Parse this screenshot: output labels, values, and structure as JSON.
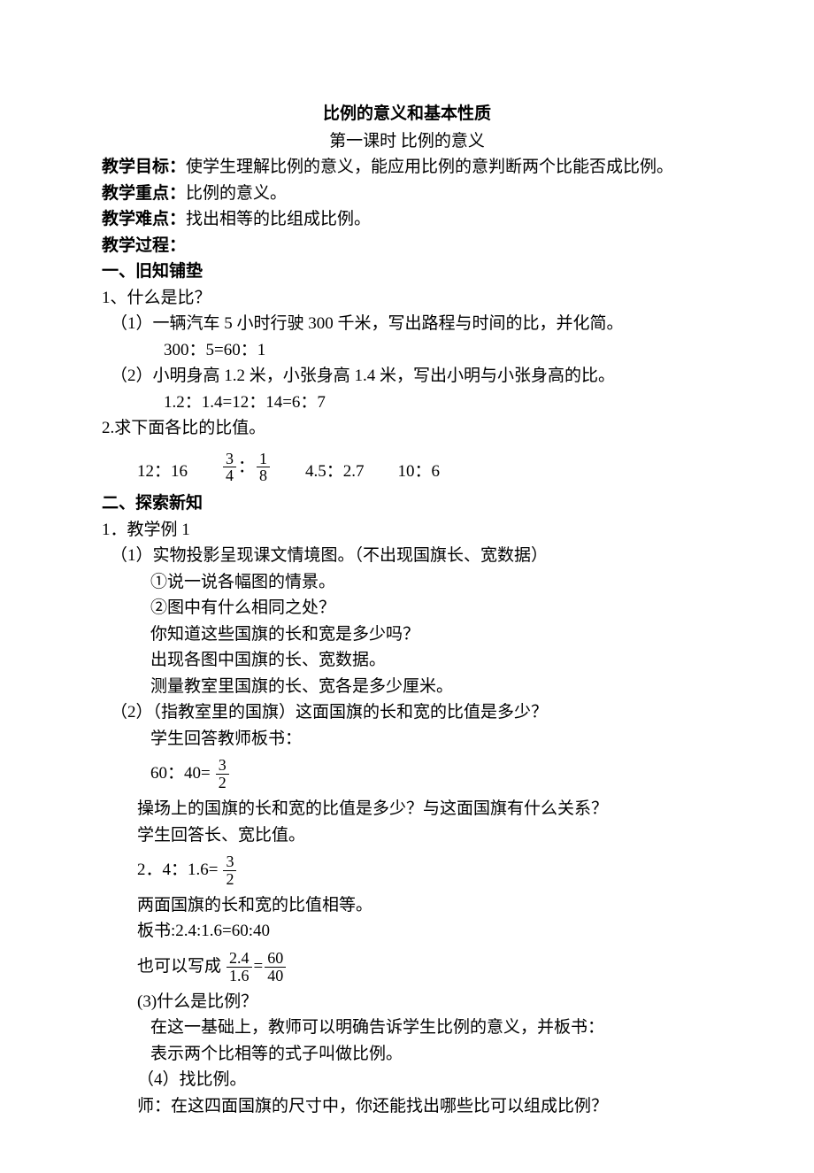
{
  "title": "比例的意义和基本性质",
  "subtitle": "第一课时 比例的意义",
  "goal_label": "教学目标：",
  "goal_text": "使学生理解比例的意义，能应用比例的意判断两个比能否成比例。",
  "focus_label": "教学重点：",
  "focus_text": "比例的意义。",
  "diff_label": "教学难点：",
  "diff_text": "找出相等的比组成比例。",
  "proc_label": "教学过程：",
  "s1_h": "一、旧知铺垫",
  "s1_q1": "1、什么是比？",
  "s1_q1a": "（1）一辆汽车 5 小时行驶 300 千米，写出路程与时间的比，并化简。",
  "s1_q1a_eq": "300：5=60：1",
  "s1_q1b": "（2）小明身高 1.2 米，小张身高 1.4 米，写出小明与小张身高的比。",
  "s1_q1b_eq": "1.2：1.4=12：14=6：7",
  "s1_q2": "2.求下面各比的比值。",
  "ratios": {
    "r1": "12：16",
    "r2a": {
      "num": "3",
      "den": "4"
    },
    "r2b": {
      "num": "1",
      "den": "8"
    },
    "r3": "4.5：2.7",
    "r4": "10：6"
  },
  "s2_h": "二、探索新知",
  "s2_1": "1．教学例 1",
  "s2_1a": "（1）实物投影呈现课文情境图。（不出现国旗长、宽数据）",
  "s2_1a_i": "①说一说各幅图的情景。",
  "s2_1a_ii": "②图中有什么相同之处？",
  "s2_1a_q1": "你知道这些国旗的长和宽是多少吗？",
  "s2_1a_q2": "出现各图中国旗的长、宽数据。",
  "s2_1a_q3": "测量教室里国旗的长、宽各是多少厘米。",
  "s2_1b": "（2）（指教室里的国旗）这面国旗的长和宽的比值是多少？",
  "s2_1b_ans": "学生回答教师板书：",
  "eq1_pre": "60：40=",
  "eq1_frac": {
    "num": "3",
    "den": "2"
  },
  "s2_q_op": "操场上的国旗的长和宽的比值是多少？与这面国旗有什么关系？",
  "s2_ans_op": "学生回答长、宽比值。",
  "eq2_pre": "2．4：1.6=",
  "eq2_frac": {
    "num": "3",
    "den": "2"
  },
  "s2_eq_note": "两面国旗的长和宽的比值相等。",
  "s2_board": "板书:2.4:1.6=60:40",
  "s2_also": "也可以写成",
  "eq3_a": {
    "num": "2.4",
    "den": "1.6"
  },
  "eq3_eq": "=",
  "eq3_b": {
    "num": "60",
    "den": "40"
  },
  "s2_3": "(3)什么是比例？",
  "s2_3a": "在这一基础上，教师可以明确告诉学生比例的意义，并板书：",
  "s2_3b": "表示两个比相等的式子叫做比例。",
  "s2_4": "（4）找比例。",
  "s2_4a": "师：在这四面国旗的尺寸中，你还能找出哪些比可以组成比例？"
}
